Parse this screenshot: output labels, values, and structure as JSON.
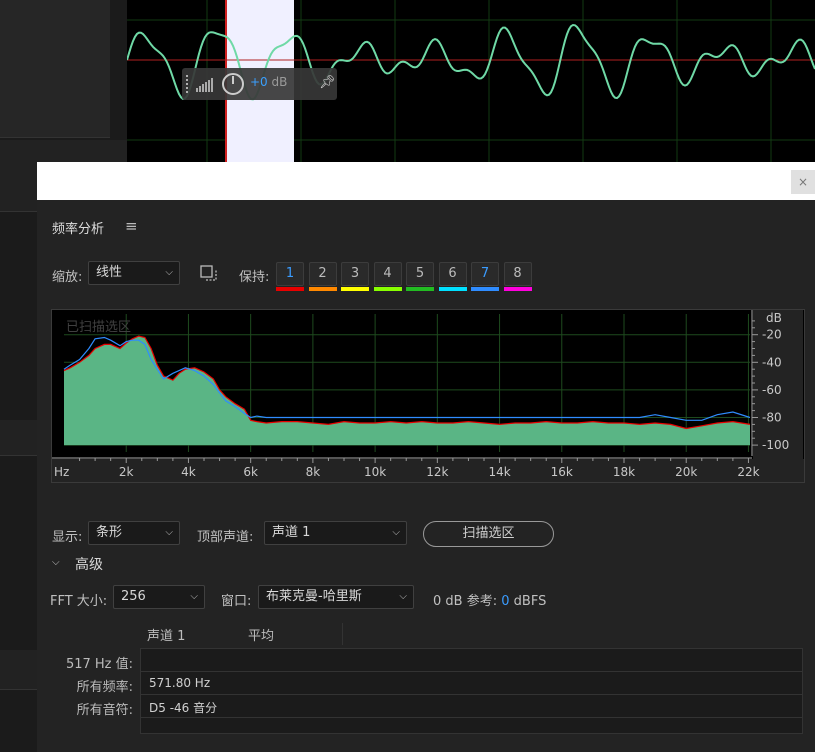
{
  "hud": {
    "gain_sign": "+0",
    "gain_unit": " dB"
  },
  "panel": {
    "title": "频率分析",
    "close_label": "×"
  },
  "controls": {
    "scale_label": "缩放:",
    "scale_value": "线性",
    "hold_label": "保持:",
    "hold_buttons": [
      {
        "label": "1",
        "active": true,
        "color": "#e80000"
      },
      {
        "label": "2",
        "active": false,
        "color": "#ff8800"
      },
      {
        "label": "3",
        "active": false,
        "color": "#ffff00"
      },
      {
        "label": "4",
        "active": false,
        "color": "#88ff00"
      },
      {
        "label": "5",
        "active": false,
        "color": "#22bb22"
      },
      {
        "label": "6",
        "active": false,
        "color": "#00e0ff"
      },
      {
        "label": "7",
        "active": true,
        "color": "#2f8cff"
      },
      {
        "label": "8",
        "active": false,
        "color": "#ff00dd"
      }
    ],
    "display_label": "显示:",
    "display_value": "条形",
    "top_channel_label": "顶部声道:",
    "top_channel_value": "声道 1",
    "scan_button": "扫描选区",
    "advanced_label": "高级",
    "fft_label": "FFT 大小:",
    "fft_value": "256",
    "window_label": "窗口:",
    "window_value": "布莱克曼-哈里斯",
    "ref_label": "0 dB 参考:",
    "ref_value": "0",
    "ref_unit": "dBFS"
  },
  "chart_data": {
    "type": "area",
    "title": "已扫描选区",
    "x_unit_label": "Hz",
    "y_unit_label": "dB",
    "x_ticks": [
      "2k",
      "4k",
      "6k",
      "8k",
      "10k",
      "12k",
      "14k",
      "16k",
      "18k",
      "20k",
      "22k"
    ],
    "y_ticks": [
      "-20",
      "-40",
      "-60",
      "-80",
      "-100"
    ],
    "xlim": [
      0,
      22050
    ],
    "ylim": [
      -105,
      -5
    ],
    "grid": true,
    "series": [
      {
        "label": "1",
        "color": "#e80000",
        "fill": "#5ab585",
        "x": [
          0,
          200,
          500,
          800,
          1000,
          1300,
          1500,
          1800,
          2000,
          2200,
          2400,
          2600,
          2800,
          3000,
          3200,
          3500,
          3700,
          3900,
          4200,
          4500,
          4800,
          5000,
          5200,
          5500,
          5800,
          6000,
          6200,
          6500,
          7000,
          7500,
          8000,
          8500,
          9000,
          9500,
          10000,
          10500,
          11000,
          11500,
          12000,
          12500,
          13000,
          13500,
          14000,
          14500,
          15000,
          15500,
          16000,
          16500,
          17000,
          17500,
          18000,
          18500,
          19000,
          19500,
          20000,
          20500,
          21000,
          21500,
          22050
        ],
        "y": [
          -46,
          -44,
          -40,
          -35,
          -30,
          -27,
          -27,
          -30,
          -26,
          -23,
          -21,
          -22,
          -30,
          -42,
          -50,
          -53,
          -48,
          -45,
          -44,
          -47,
          -52,
          -60,
          -65,
          -70,
          -74,
          -82,
          -83,
          -84,
          -83,
          -83,
          -84,
          -85,
          -83,
          -84,
          -84,
          -83,
          -84,
          -83,
          -84,
          -84,
          -83,
          -84,
          -85,
          -84,
          -84,
          -83,
          -84,
          -84,
          -83,
          -84,
          -84,
          -85,
          -84,
          -85,
          -88,
          -86,
          -84,
          -83,
          -85
        ]
      },
      {
        "label": "7",
        "color": "#2f8cff",
        "x": [
          0,
          200,
          500,
          800,
          1000,
          1300,
          1500,
          1800,
          2000,
          2200,
          2400,
          2600,
          2800,
          3000,
          3200,
          3500,
          3700,
          3900,
          4200,
          4500,
          4800,
          5000,
          5200,
          5500,
          5800,
          6000,
          6200,
          6500,
          7000,
          7500,
          8000,
          8500,
          9000,
          9500,
          10000,
          10500,
          11000,
          11500,
          12000,
          12500,
          13000,
          13500,
          14000,
          14500,
          15000,
          15500,
          16000,
          16500,
          17000,
          17500,
          18000,
          18500,
          19000,
          19500,
          20000,
          20500,
          21000,
          21500,
          22050
        ],
        "y": [
          -45,
          -42,
          -38,
          -30,
          -23,
          -22,
          -24,
          -28,
          -25,
          -24,
          -24,
          -27,
          -38,
          -45,
          -52,
          -48,
          -46,
          -44,
          -46,
          -50,
          -56,
          -62,
          -68,
          -72,
          -77,
          -80,
          -79,
          -80,
          -80,
          -80,
          -80,
          -80,
          -80,
          -80,
          -80,
          -80,
          -80,
          -80,
          -80,
          -80,
          -80,
          -80,
          -80,
          -80,
          -80,
          -80,
          -80,
          -80,
          -80,
          -80,
          -80,
          -80,
          -78,
          -80,
          -82,
          -82,
          -78,
          -76,
          -80
        ]
      }
    ]
  },
  "info": {
    "col1": "声道 1",
    "col2": "平均",
    "rows": [
      {
        "label": "517 Hz 值:",
        "value": ""
      },
      {
        "label": "所有频率:",
        "value": "571.80 Hz"
      },
      {
        "label": "所有音符:",
        "value": "D5 -46 音分"
      }
    ]
  }
}
